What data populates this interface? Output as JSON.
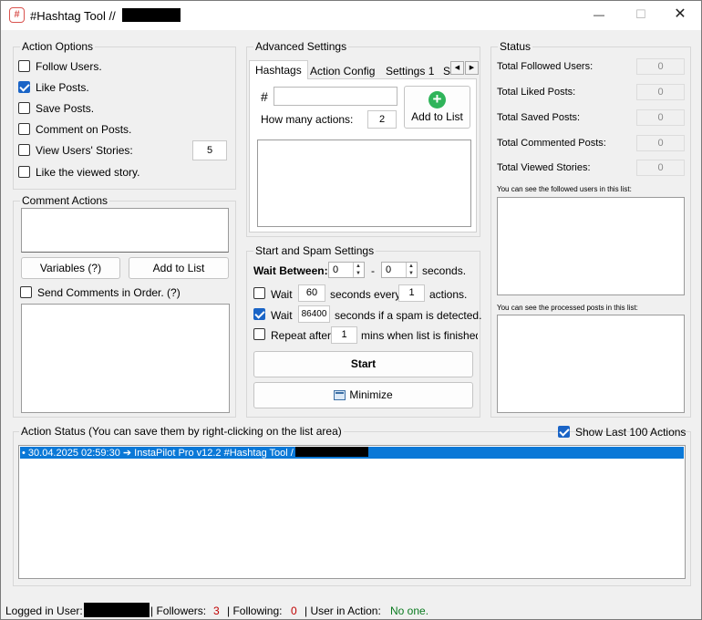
{
  "window": {
    "title": "#Hashtag Tool //",
    "minimize_glyph": "—",
    "maximize_glyph": "☐",
    "close_glyph": "✕",
    "icon_glyph": "#"
  },
  "action_options": {
    "title": "Action Options",
    "follow_users": {
      "label": "Follow Users.",
      "checked": false
    },
    "like_posts": {
      "label": "Like Posts.",
      "checked": true
    },
    "save_posts": {
      "label": "Save Posts.",
      "checked": false
    },
    "comment_posts": {
      "label": "Comment on Posts.",
      "checked": false
    },
    "view_stories": {
      "label": "View Users' Stories:",
      "checked": false,
      "value": "5"
    },
    "like_viewed_story": {
      "label": "Like the viewed story.",
      "checked": false
    }
  },
  "comment_actions": {
    "title": "Comment Actions",
    "variables_button": "Variables (?)",
    "add_to_list_button": "Add to List",
    "send_in_order": {
      "label": "Send Comments in Order. (?)",
      "checked": false
    }
  },
  "advanced_settings": {
    "title": "Advanced Settings",
    "tabs": [
      "Hashtags",
      "Action Config",
      "Settings 1",
      "S"
    ],
    "hash_symbol": "#",
    "hashtag_input": "",
    "how_many_label": "How many actions:",
    "how_many_value": "2",
    "add_to_list_button": "Add to List",
    "add_icon_glyph": "+",
    "tab_scroll_left": "◀",
    "tab_scroll_right": "▶"
  },
  "start_spam": {
    "title": "Start and Spam Settings",
    "wait_between_label": "Wait Between:",
    "wait_min": "0",
    "dash": "-",
    "wait_max": "0",
    "seconds_label": "seconds.",
    "wait_every": {
      "checked": false,
      "label": "Wait",
      "value": "60",
      "mid_label": "seconds every",
      "count": "1",
      "end_label": "actions."
    },
    "wait_spam": {
      "checked": true,
      "label": "Wait",
      "value": "86400",
      "end_label": "seconds if a spam is detected."
    },
    "repeat": {
      "checked": false,
      "label": "Repeat after",
      "value": "1",
      "end_label": "mins when list is finished"
    },
    "start_button": "Start",
    "minimize_button": "Minimize",
    "spin_up": "▲",
    "spin_down": "▼"
  },
  "status": {
    "title": "Status",
    "rows": [
      {
        "label": "Total Followed Users:",
        "value": "0"
      },
      {
        "label": "Total Liked Posts:",
        "value": "0"
      },
      {
        "label": "Total Saved Posts:",
        "value": "0"
      },
      {
        "label": "Total Commented Posts:",
        "value": "0"
      },
      {
        "label": "Total Viewed Stories:",
        "value": "0"
      }
    ],
    "followed_list_caption": "You can see the followed users in this list:",
    "processed_list_caption": "You can see the processed posts in this list:"
  },
  "action_status": {
    "title": "Action Status (You can save them by right-clicking on the list area)",
    "show_last": {
      "label": "Show Last 100 Actions",
      "checked": true
    },
    "log_entry": "• 30.04.2025 02:59:30 ➔ InstaPilot Pro v12.2 #Hashtag Tool /"
  },
  "statusbar": {
    "logged_in_label": "Logged in User:",
    "followers_label": "|  Followers:",
    "followers_value": "3",
    "following_label": "|  Following:",
    "following_value": "0",
    "user_in_action_label": "|  User in Action:",
    "user_in_action_value": "No one."
  },
  "colors": {
    "accent": "#1a64c6",
    "selection": "#0a78d7",
    "followers_value": "#c00000",
    "user_in_action_value": "#0a7a1f",
    "add_icon": "#2fb45a"
  }
}
